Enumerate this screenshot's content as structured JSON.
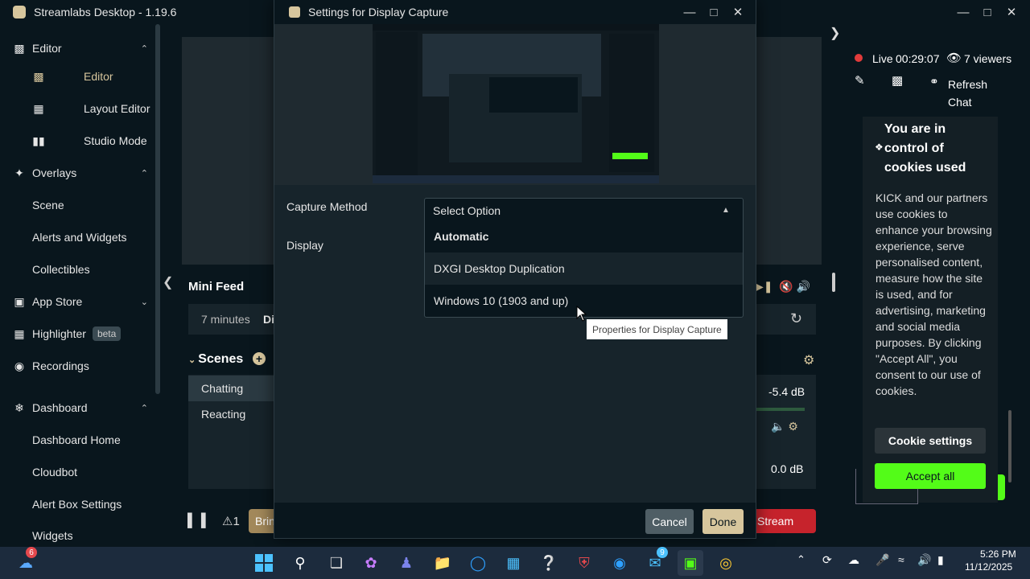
{
  "app": {
    "title": "Streamlabs Desktop - 1.19.6"
  },
  "sidebar": {
    "items": [
      {
        "label": "Editor",
        "type": "section",
        "icon": "editor-icon"
      },
      {
        "label": "Editor",
        "type": "sub",
        "icon": "editor-sub-icon",
        "active": true
      },
      {
        "label": "Layout Editor",
        "type": "sub",
        "icon": "layout-icon"
      },
      {
        "label": "Studio Mode",
        "type": "sub",
        "icon": "studio-icon"
      },
      {
        "label": "Overlays",
        "type": "section",
        "icon": "overlays-icon"
      },
      {
        "label": "Scene",
        "type": "sub"
      },
      {
        "label": "Alerts and Widgets",
        "type": "sub"
      },
      {
        "label": "Collectibles",
        "type": "sub"
      },
      {
        "label": "App Store",
        "type": "section",
        "icon": "store-icon"
      },
      {
        "label": "Highlighter",
        "type": "section",
        "icon": "highlighter-icon",
        "badge": "beta"
      },
      {
        "label": "Recordings",
        "type": "section",
        "icon": "recordings-icon"
      },
      {
        "label": "Dashboard",
        "type": "section",
        "icon": "dashboard-icon"
      },
      {
        "label": "Dashboard Home",
        "type": "sub"
      },
      {
        "label": "Cloudbot",
        "type": "sub"
      },
      {
        "label": "Alert Box Settings",
        "type": "sub"
      },
      {
        "label": "Widgets",
        "type": "sub"
      }
    ]
  },
  "editor": {
    "mini_feed_title": "Mini Feed",
    "mini_feed_time": "7 minutes",
    "mini_feed_partial": "Di",
    "scenes_title": "Scenes",
    "scenes": [
      "Chatting",
      "Reacting"
    ],
    "mixer_db": [
      "-5.4 dB",
      "0.0 dB"
    ]
  },
  "footer": {
    "alert_count": "1",
    "bring_partial": "Brin",
    "stream_partial": "Stream"
  },
  "modal": {
    "title": "Settings for Display Capture",
    "capture_method_label": "Capture Method",
    "display_label": "Display",
    "select_placeholder": "Select Option",
    "options": [
      "Automatic",
      "DXGI Desktop Duplication",
      "Windows 10 (1903 and up)"
    ],
    "tooltip": "Properties for Display Capture",
    "cancel": "Cancel",
    "done": "Done"
  },
  "chat": {
    "live_label": "Live",
    "live_time": "00:29:07",
    "viewers": "7 viewers",
    "refresh_chat": "Refresh Chat",
    "cookie_title": "You are in control of cookies used",
    "cookie_body": "KICK and our partners use cookies to enhance your browsing experience, serve personalised content, measure how the site is used, and for advertising, marketing and social media purposes. By clicking \"Accept All\", you consent to our use of cookies.",
    "cookie_settings": "Cookie settings",
    "accept_all": "Accept all"
  },
  "taskbar": {
    "weather_badge": "6",
    "teams_badge": "9",
    "time": "5:26 PM",
    "date": "11/12/2025"
  },
  "colors": {
    "accent": "#d7c69d",
    "kick_green": "#53fc18",
    "live_red": "#e23b3b",
    "stream_red": "#c6232c"
  }
}
